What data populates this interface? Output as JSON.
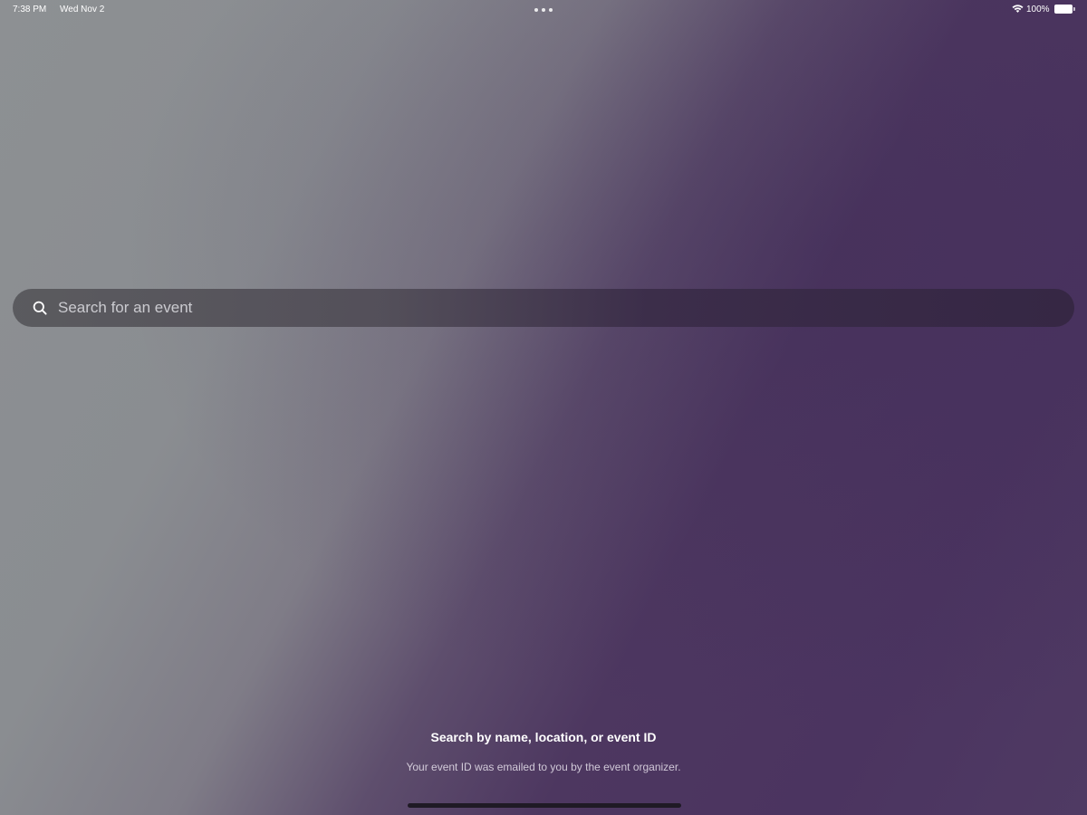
{
  "status_bar": {
    "time": "7:38 PM",
    "date": "Wed Nov 2",
    "battery_percent": "100%",
    "icons": [
      "multitask-dots-icon",
      "wifi-icon",
      "battery-icon"
    ],
    "battery_level": 1.0
  },
  "search": {
    "placeholder": "Search for an event",
    "value": "",
    "icon": "search-icon"
  },
  "hint": {
    "title": "Search by name, location, or event ID",
    "subtitle": "Your event ID was emailed to you by the event organizer."
  },
  "colors": {
    "background_gray": "#8d9093",
    "background_purple": "#4b3460",
    "text": "#ffffff"
  }
}
